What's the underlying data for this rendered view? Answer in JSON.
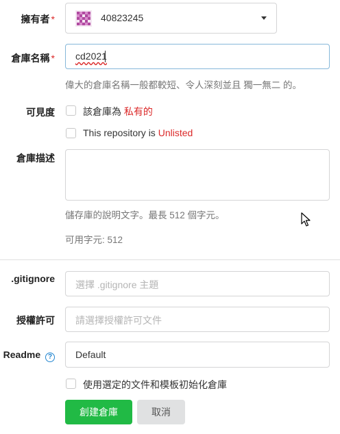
{
  "owner": {
    "label": "擁有者",
    "required_mark": "*",
    "value": "40823245"
  },
  "repo_name": {
    "label": "倉庫名稱",
    "required_mark": "*",
    "value": "cd2021",
    "help": "偉大的倉庫名稱一般都較短、令人深刻並且 獨一無二 的。"
  },
  "visibility": {
    "label": "可見度",
    "private_prefix": "該倉庫為 ",
    "private_highlight": "私有的",
    "unlisted_prefix": "This repository is ",
    "unlisted_highlight": "Unlisted"
  },
  "description": {
    "label": "倉庫描述",
    "value": "",
    "help": "儲存庫的說明文字。最長 512 個字元。",
    "remaining": "可用字元: 512"
  },
  "gitignore": {
    "label": ".gitignore",
    "placeholder": "選擇 .gitignore 主題"
  },
  "license": {
    "label": "授權許可",
    "placeholder": "請選擇授權許可文件"
  },
  "readme": {
    "label": "Readme",
    "value": "Default"
  },
  "auto_init": {
    "label": "使用選定的文件和模板初始化倉庫"
  },
  "actions": {
    "create_label": "創建倉庫",
    "cancel_label": "取消"
  },
  "colors": {
    "accent_green": "#21ba45",
    "required_red": "#db2828",
    "focus_blue": "#85b7d9",
    "help_blue": "#2185d0"
  },
  "icons": {
    "owner_avatar": "identicon-avatar",
    "dropdown": "caret-down-icon",
    "readme_help": "question-circle-icon",
    "cursor": "mouse-pointer-icon"
  }
}
